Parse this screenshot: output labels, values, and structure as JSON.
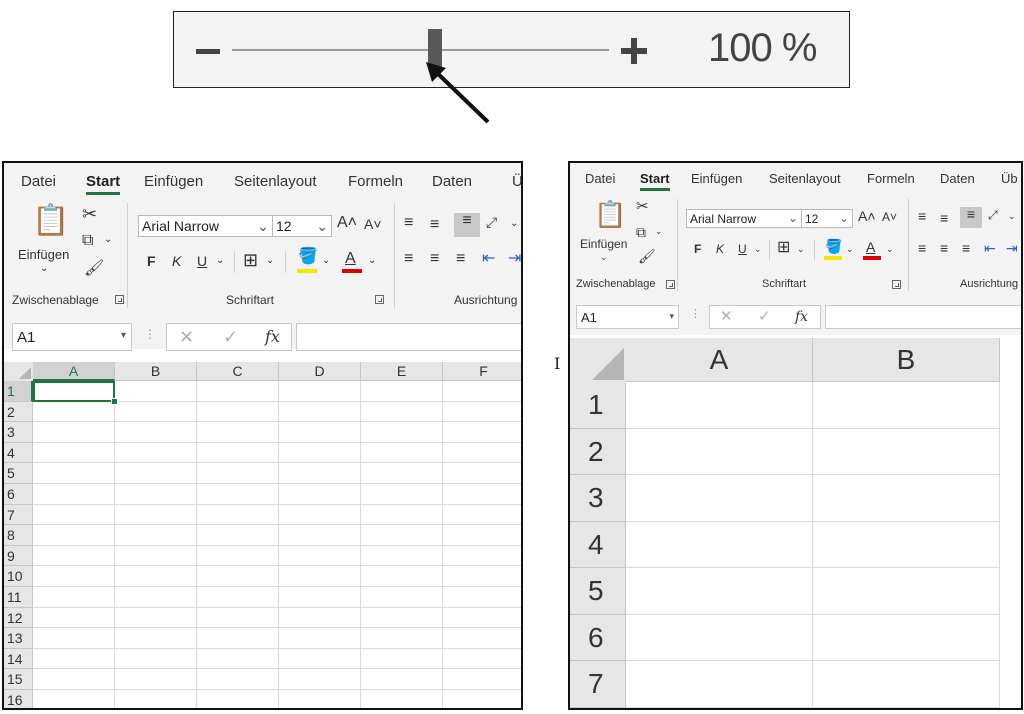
{
  "zoom": {
    "minus_label": "–",
    "plus_label": "+",
    "level_text": "100 %",
    "slider_position": 0.5
  },
  "left": {
    "tabs": [
      "Datei",
      "Start",
      "Einfügen",
      "Seitenlayout",
      "Formeln",
      "Daten",
      "Übe"
    ],
    "active_tab": "Start",
    "groups": [
      "Zwischenablage",
      "Schriftart",
      "Ausrichtung"
    ],
    "paste_label": "Einfügen",
    "font_name": "Arial Narrow",
    "font_size": "12",
    "bold": "F",
    "italic": "K",
    "underline": "U",
    "increase_font": "A˄",
    "decrease_font": "A˅",
    "font_color_letter": "A",
    "name_box": "A1",
    "fx_label": "fx",
    "columns": [
      "A",
      "B",
      "C",
      "D",
      "E",
      "F"
    ],
    "rows": [
      "1",
      "2",
      "3",
      "4",
      "5",
      "6",
      "7",
      "8",
      "9",
      "10",
      "11",
      "12",
      "13",
      "14",
      "15",
      "16"
    ],
    "active_cell": "A1"
  },
  "right": {
    "tabs": [
      "Datei",
      "Start",
      "Einfügen",
      "Seitenlayout",
      "Formeln",
      "Daten",
      "Üb"
    ],
    "active_tab": "Start",
    "groups": [
      "Zwischenablage",
      "Schriftart",
      "Ausrichtung"
    ],
    "paste_label": "Einfügen",
    "font_name": "Arial Narrow",
    "font_size": "12",
    "bold": "F",
    "italic": "K",
    "underline": "U",
    "increase_font": "A˄",
    "decrease_font": "A˅",
    "font_color_letter": "A",
    "name_box": "A1",
    "fx_label": "fx",
    "columns": [
      "A",
      "B"
    ],
    "rows": [
      "1",
      "2",
      "3",
      "4",
      "5",
      "6",
      "7"
    ]
  },
  "colors": {
    "accent_green": "#217346",
    "highlight_yellow": "#f5e600",
    "font_red": "#e00000"
  },
  "icons": [
    "cut-icon",
    "copy-icon",
    "format-painter-icon",
    "paste-icon",
    "border-icon",
    "fill-color-icon",
    "align-icon",
    "orientation-icon",
    "cancel-icon",
    "enter-icon",
    "cursor-ibeam-icon",
    "pointer-arrow-icon"
  ]
}
